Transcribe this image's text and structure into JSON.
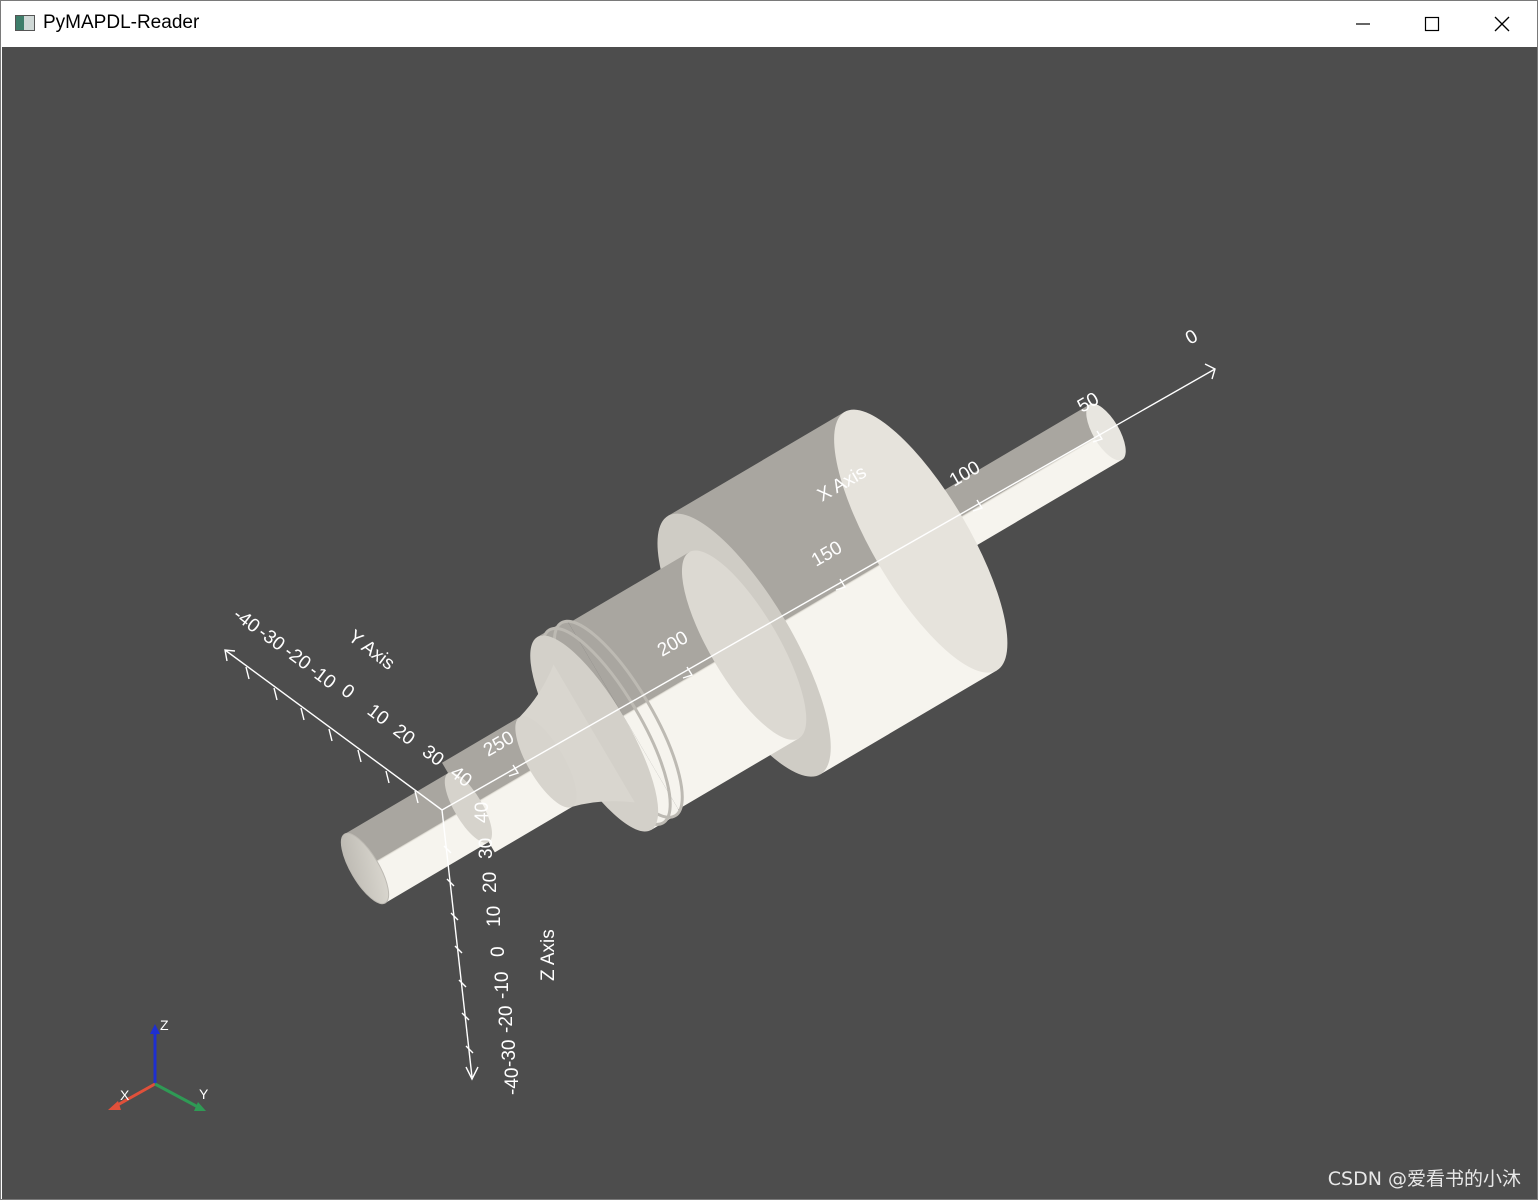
{
  "window": {
    "title": "PyMAPDL-Reader",
    "controls": [
      "minimize",
      "maximize",
      "close"
    ]
  },
  "scene": {
    "background_color": "#4d4d4d",
    "model_color": "#e8e6e0",
    "axes": {
      "x_label": "X Axis",
      "y_label": "Y Axis",
      "z_label": "Z Axis",
      "x_ticks": [
        "0",
        "50",
        "100",
        "150",
        "200",
        "250"
      ],
      "y_ticks": [
        "-40",
        "-30",
        "-20",
        "-10",
        "0",
        "10",
        "20",
        "30",
        "40"
      ],
      "z_ticks": [
        "40",
        "30",
        "20",
        "10",
        "0",
        "-10",
        "-20",
        "-30",
        "-40"
      ]
    },
    "orientation_widget": {
      "x": "X",
      "y": "Y",
      "z": "Z",
      "x_color": "#e0503a",
      "y_color": "#2f9a55",
      "z_color": "#1e2fd0"
    }
  },
  "watermark": "CSDN @爱看书的小沐"
}
